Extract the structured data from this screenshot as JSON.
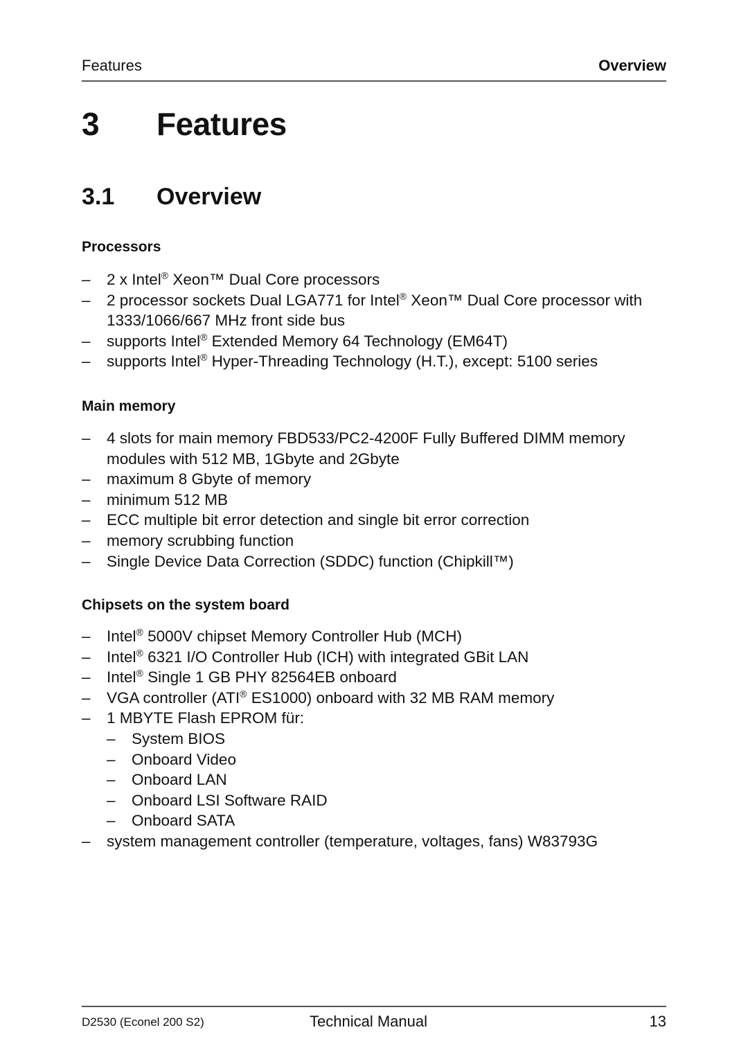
{
  "header": {
    "left": "Features",
    "right": "Overview"
  },
  "chapter": {
    "number": "3",
    "title": "Features"
  },
  "section": {
    "number": "3.1",
    "title": "Overview"
  },
  "groups": [
    {
      "heading": "Processors",
      "items": [
        {
          "parts": [
            "2 x Intel",
            "®",
            " Xeon™ Dual Core processors"
          ]
        },
        {
          "parts": [
            "2 processor sockets Dual LGA771 for Intel",
            "®",
            " Xeon™ Dual Core processor with 1333/1066/667 MHz front side bus"
          ]
        },
        {
          "parts": [
            "supports Intel",
            "®",
            " Extended Memory 64 Technology (EM64T)"
          ]
        },
        {
          "parts": [
            "supports Intel",
            "®",
            " Hyper-Threading Technology (H.T.), except: 5100 series"
          ]
        }
      ]
    },
    {
      "heading": "Main memory",
      "items": [
        {
          "text": "4 slots for main memory FBD533/PC2-4200F Fully Buffered DIMM memory modules with 512 MB, 1Gbyte and 2Gbyte"
        },
        {
          "text": "maximum 8 Gbyte of memory"
        },
        {
          "text": "minimum 512 MB"
        },
        {
          "text": "ECC multiple bit error detection and single bit error correction"
        },
        {
          "text": "memory scrubbing function"
        },
        {
          "text": "Single Device Data Correction (SDDC) function (Chipkill™)"
        }
      ]
    },
    {
      "heading": "Chipsets on the system board",
      "items": [
        {
          "parts": [
            "Intel",
            "®",
            " 5000V chipset Memory Controller Hub (MCH)"
          ]
        },
        {
          "parts": [
            "Intel",
            "®",
            " 6321 I/O Controller Hub (ICH) with integrated GBit LAN"
          ]
        },
        {
          "parts": [
            "Intel",
            "®",
            " Single 1 GB PHY 82564EB onboard"
          ]
        },
        {
          "parts": [
            "VGA controller (ATI",
            "®",
            " ES1000) onboard with 32 MB RAM memory"
          ]
        },
        {
          "text": "1 MBYTE Flash EPROM für:",
          "sub": [
            "System BIOS",
            "Onboard Video",
            "Onboard LAN",
            "Onboard LSI Software RAID",
            "Onboard SATA"
          ]
        },
        {
          "text": "system management controller (temperature, voltages, fans) W83793G"
        }
      ]
    }
  ],
  "dash": "–",
  "footer": {
    "code": "D2530 (Econel 200 S2)",
    "manual": "Technical Manual",
    "page": "13"
  }
}
